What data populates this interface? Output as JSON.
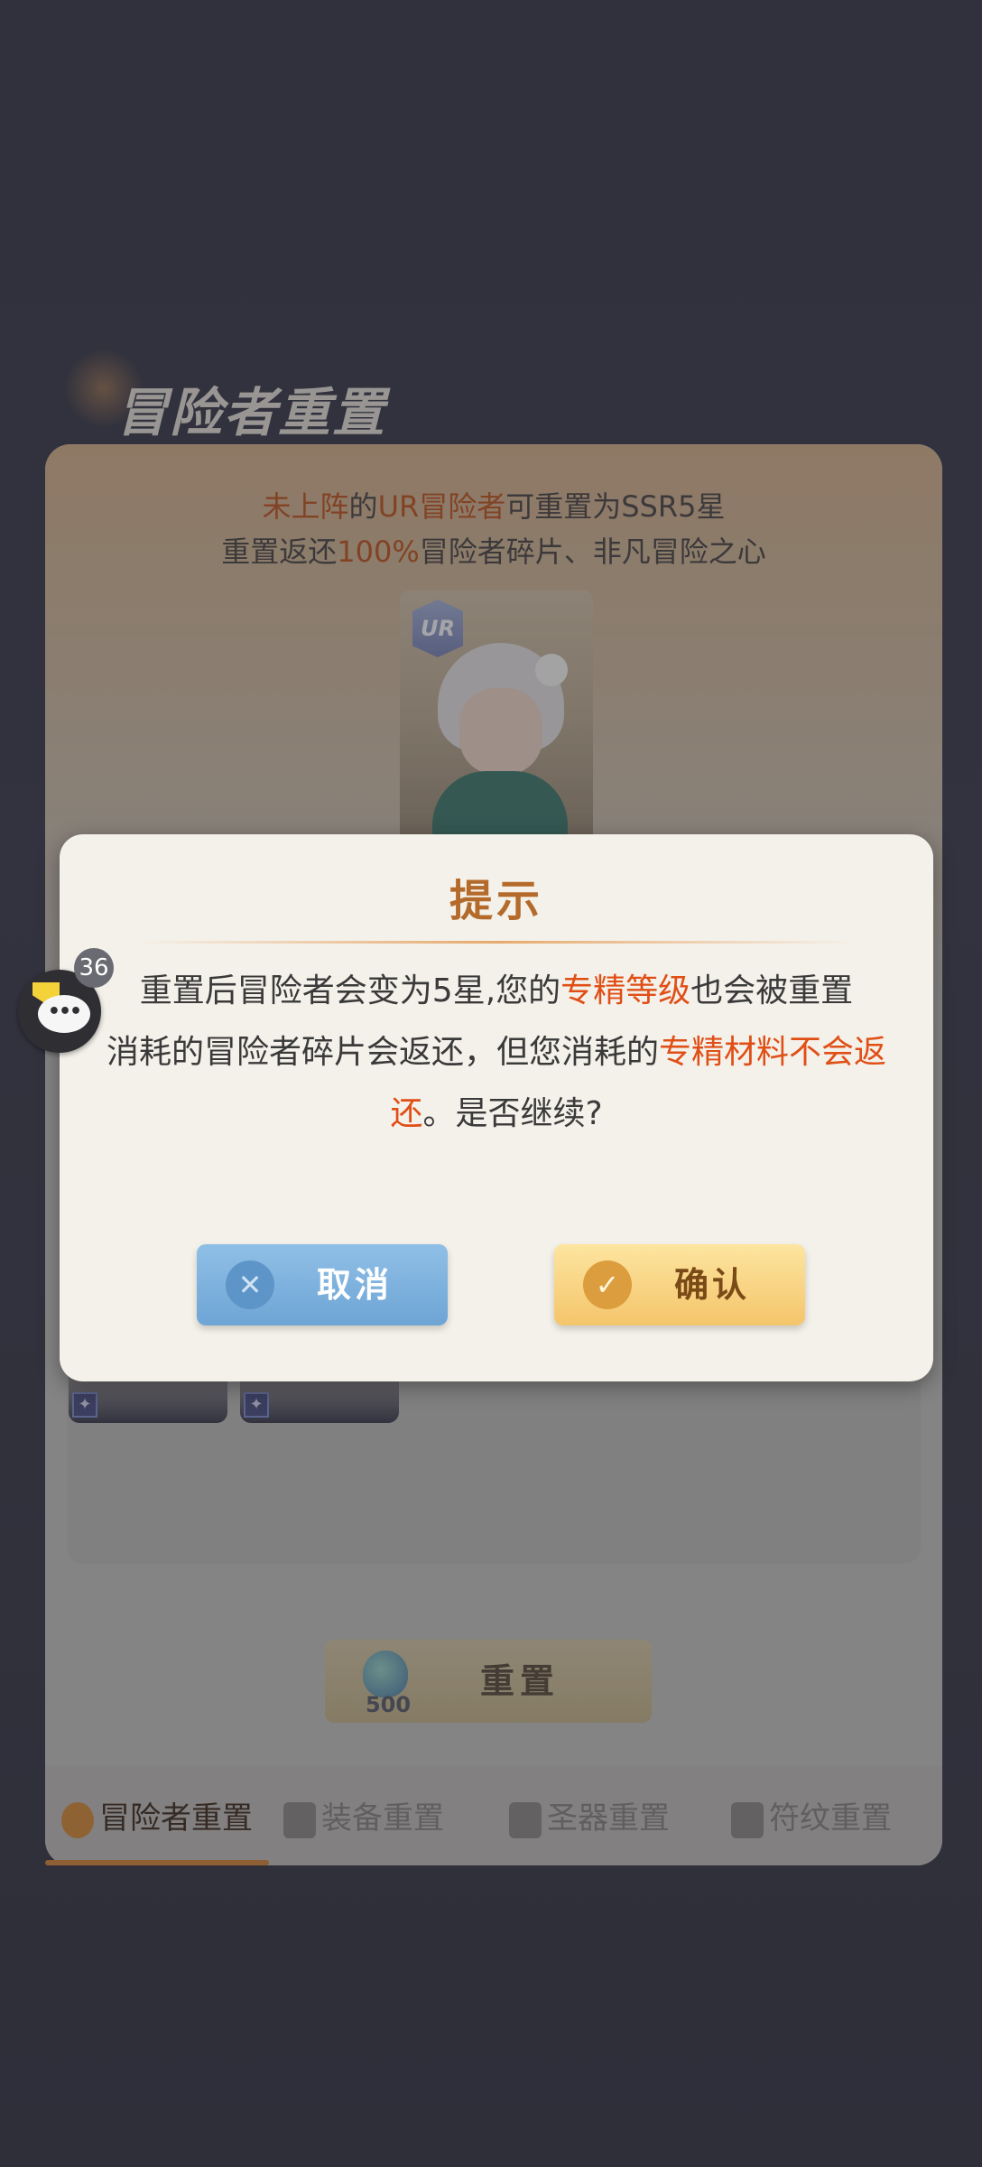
{
  "panel": {
    "title": "冒险者重置",
    "info_line1": {
      "a": "未上阵",
      "b": "的",
      "c": "UR冒险者",
      "d": "可重置为SSR5星"
    },
    "info_line2": {
      "a": "重置返还",
      "b": "100%",
      "c": "冒险者碎片、非凡冒险之心"
    },
    "card_badge": "UR",
    "reset_button": {
      "label": "重置",
      "cost": "500"
    },
    "tabs": [
      {
        "label": "冒险者重置",
        "active": true
      },
      {
        "label": "装备重置",
        "active": false
      },
      {
        "label": "圣器重置",
        "active": false
      },
      {
        "label": "符纹重置",
        "active": false
      }
    ]
  },
  "dialog": {
    "title": "提示",
    "body": {
      "p1": "重置后冒险者会变为5星,您的",
      "p1_hl": "专精等级",
      "p1_end": "也会被重置",
      "p2": "消耗的冒险者碎片会返还，但您消耗的",
      "p2_hl": "专精材料不会返还",
      "p2_end": "。是否继续?"
    },
    "cancel_label": "取消",
    "confirm_label": "确认"
  },
  "chat_float": {
    "badge_count": "36"
  },
  "colors": {
    "highlight": "#e04f16",
    "title": "#b46a2a",
    "cancel": "#7bb0dd",
    "confirm": "#f6cf7a",
    "tab_active": "#d88733"
  }
}
